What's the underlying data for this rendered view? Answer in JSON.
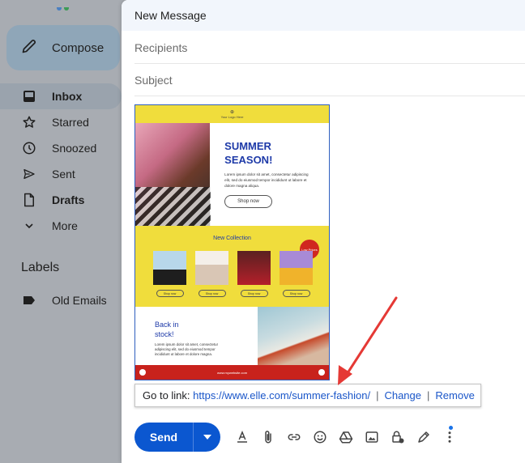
{
  "sidebar": {
    "compose_label": "Compose",
    "items": [
      {
        "label": "Inbox",
        "icon": "inbox-icon"
      },
      {
        "label": "Starred",
        "icon": "star-icon"
      },
      {
        "label": "Snoozed",
        "icon": "clock-icon"
      },
      {
        "label": "Sent",
        "icon": "send-icon"
      },
      {
        "label": "Drafts",
        "icon": "file-icon"
      },
      {
        "label": "More",
        "icon": "chevron-down-icon"
      }
    ],
    "labels_title": "Labels",
    "labels": [
      {
        "label": "Old Emails",
        "icon": "label-icon"
      }
    ]
  },
  "compose": {
    "title": "New Message",
    "recipients_placeholder": "Recipients",
    "subject_placeholder": "Subject"
  },
  "template": {
    "logo_text": "Your Logo Here",
    "hero_title_1": "SUMMER",
    "hero_title_2": "SEASON!",
    "hero_body": "Lorem ipsum dolor sit amet, consectetur adipiscing elit, sed do eiusmod tempor incididunt ut labore et dolore magna aliqua.",
    "hero_button": "Shop now",
    "collection_title": "New Collection",
    "badge_text": "Low Prices",
    "product_button": "Shop now",
    "back_title_1": "Back in",
    "back_title_2": "stock!",
    "back_body": "Lorem ipsum dolor sit amet, consectetur adipiscing elit, sed do eiusmod tempor incididunt ut labore et dolore magna.",
    "footer_url": "www.mywebsite.com"
  },
  "link_popup": {
    "prefix": "Go to link:",
    "url": "https://www.elle.com/summer-fashion/",
    "change": "Change",
    "remove": "Remove",
    "separator": "|"
  },
  "toolbar": {
    "send_label": "Send"
  },
  "colors": {
    "send_blue": "#0b57d0",
    "link_blue": "#1a56c9",
    "arrow_red": "#e53935",
    "template_yellow": "#f0dd3c",
    "template_blue": "#1e3aa8",
    "template_red": "#c8221c"
  }
}
